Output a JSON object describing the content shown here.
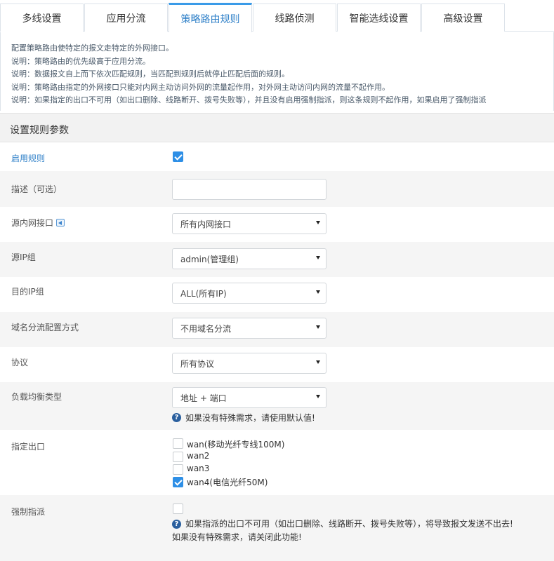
{
  "tabs": [
    {
      "label": "多线设置"
    },
    {
      "label": "应用分流"
    },
    {
      "label": "策略路由规则"
    },
    {
      "label": "线路侦测"
    },
    {
      "label": "智能选线设置"
    },
    {
      "label": "高级设置"
    }
  ],
  "notes": [
    "配置策略路由使特定的报文走特定的外网接口。",
    "说明：策略路由的优先级高于应用分流。",
    "说明：数据报文自上而下依次匹配规则，当匹配到规则后就停止匹配后面的规则。",
    "说明：策略路由指定的外网接口只能对内网主动访问外网的流量起作用，对外网主动访问内网的流量不起作用。",
    "说明：如果指定的出口不可用（如出口删除、线路断开、拨号失败等），并且没有启用强制指派，则这条规则不起作用，如果启用了强制指派"
  ],
  "section_title": "设置规则参数",
  "form": {
    "enable": {
      "label": "启用规则",
      "checked": true
    },
    "description": {
      "label": "描述（可选）",
      "value": ""
    },
    "src_interface": {
      "label": "源内网接口",
      "value": "所有内网接口",
      "icon": "back-arrow-icon"
    },
    "src_ip_group": {
      "label": "源IP组",
      "value": "admin(管理组)"
    },
    "dst_ip_group": {
      "label": "目的IP组",
      "value": "ALL(所有IP)"
    },
    "domain_mode": {
      "label": "域名分流配置方式",
      "value": "不用域名分流"
    },
    "protocol": {
      "label": "协议",
      "value": "所有协议"
    },
    "lb_type": {
      "label": "负载均衡类型",
      "value": "地址 + 端口",
      "hint": "如果没有特殊需求，请使用默认值!"
    },
    "outlet": {
      "label": "指定出口",
      "options": [
        {
          "label": "wan(移动光纤专线100M)",
          "checked": false
        },
        {
          "label": "wan2",
          "checked": false
        },
        {
          "label": "wan3",
          "checked": false
        },
        {
          "label": "wan4(电信光纤50M)",
          "checked": true
        }
      ]
    },
    "force": {
      "label": "强制指派",
      "checked": false,
      "hint_line1": "如果指派的出口不可用（如出口删除、线路断开、拨号失败等），将导致报文发送不出去!",
      "hint_line2": "如果没有特殊需求，请关闭此功能!"
    }
  },
  "colors": {
    "accent": "#2e8fe6",
    "active_tab_text": "#2f80c8",
    "label_blue": "#2f80c8",
    "row_alt": "#f5f5f5"
  }
}
